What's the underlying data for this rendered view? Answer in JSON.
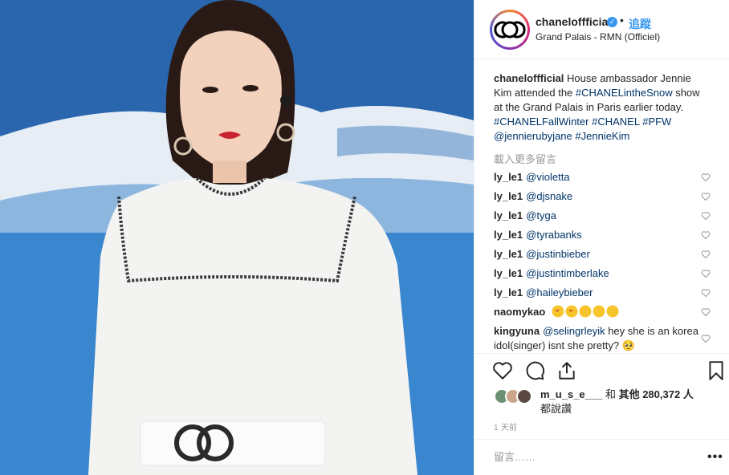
{
  "post": {
    "username": "chaneloffficial",
    "follow_label": "追蹤",
    "dot": "•",
    "verified_glyph": "✓",
    "location": "Grand Palais - RMN (Officiel)"
  },
  "caption": {
    "username": "chaneloffficial",
    "text_1": "House ambassador Jennie Kim attended the ",
    "tag_1": "#CHANELintheSnow",
    "text_2": " show at the Grand Palais in Paris earlier today. ",
    "tag_2": "#CHANELFallWinter",
    "tag_3": "#CHANEL",
    "tag_4": "#PFW",
    "tag_5": "@jennierubyjane",
    "tag_6": "#JennieKim"
  },
  "load_more_label": "載入更多留言",
  "comments": [
    {
      "user": "ly_le1",
      "text": "@violetta"
    },
    {
      "user": "ly_le1",
      "text": "@djsnake"
    },
    {
      "user": "ly_le1",
      "text": "@tyga"
    },
    {
      "user": "ly_le1",
      "text": "@tyrabanks"
    },
    {
      "user": "ly_le1",
      "text": "@justinbieber"
    },
    {
      "user": "ly_le1",
      "text": "@justintimberlake"
    },
    {
      "user": "ly_le1",
      "text": "@haileybieber"
    },
    {
      "user": "naomykao",
      "text": ""
    },
    {
      "user": "kingyuna",
      "mention": "@selingrleyik",
      "text": " hey she is an korea idol(singer) isnt she pretty? 🥺"
    }
  ],
  "likes": {
    "first_user": "m_u_s_e___",
    "and_label": " 和 ",
    "others": "其他 280,372 人",
    "suffix": "都說讚"
  },
  "time_ago": "1 天前",
  "comment_input": {
    "placeholder": "留言……"
  },
  "more_label": "•••",
  "colors": {
    "link": "#003569",
    "accent": "#3897f0",
    "muted": "#999999",
    "text": "#262626"
  },
  "icons": [
    "heart-outline-icon",
    "comment-icon",
    "share-icon",
    "bookmark-icon",
    "verified-icon",
    "chanel-logo-icon"
  ]
}
